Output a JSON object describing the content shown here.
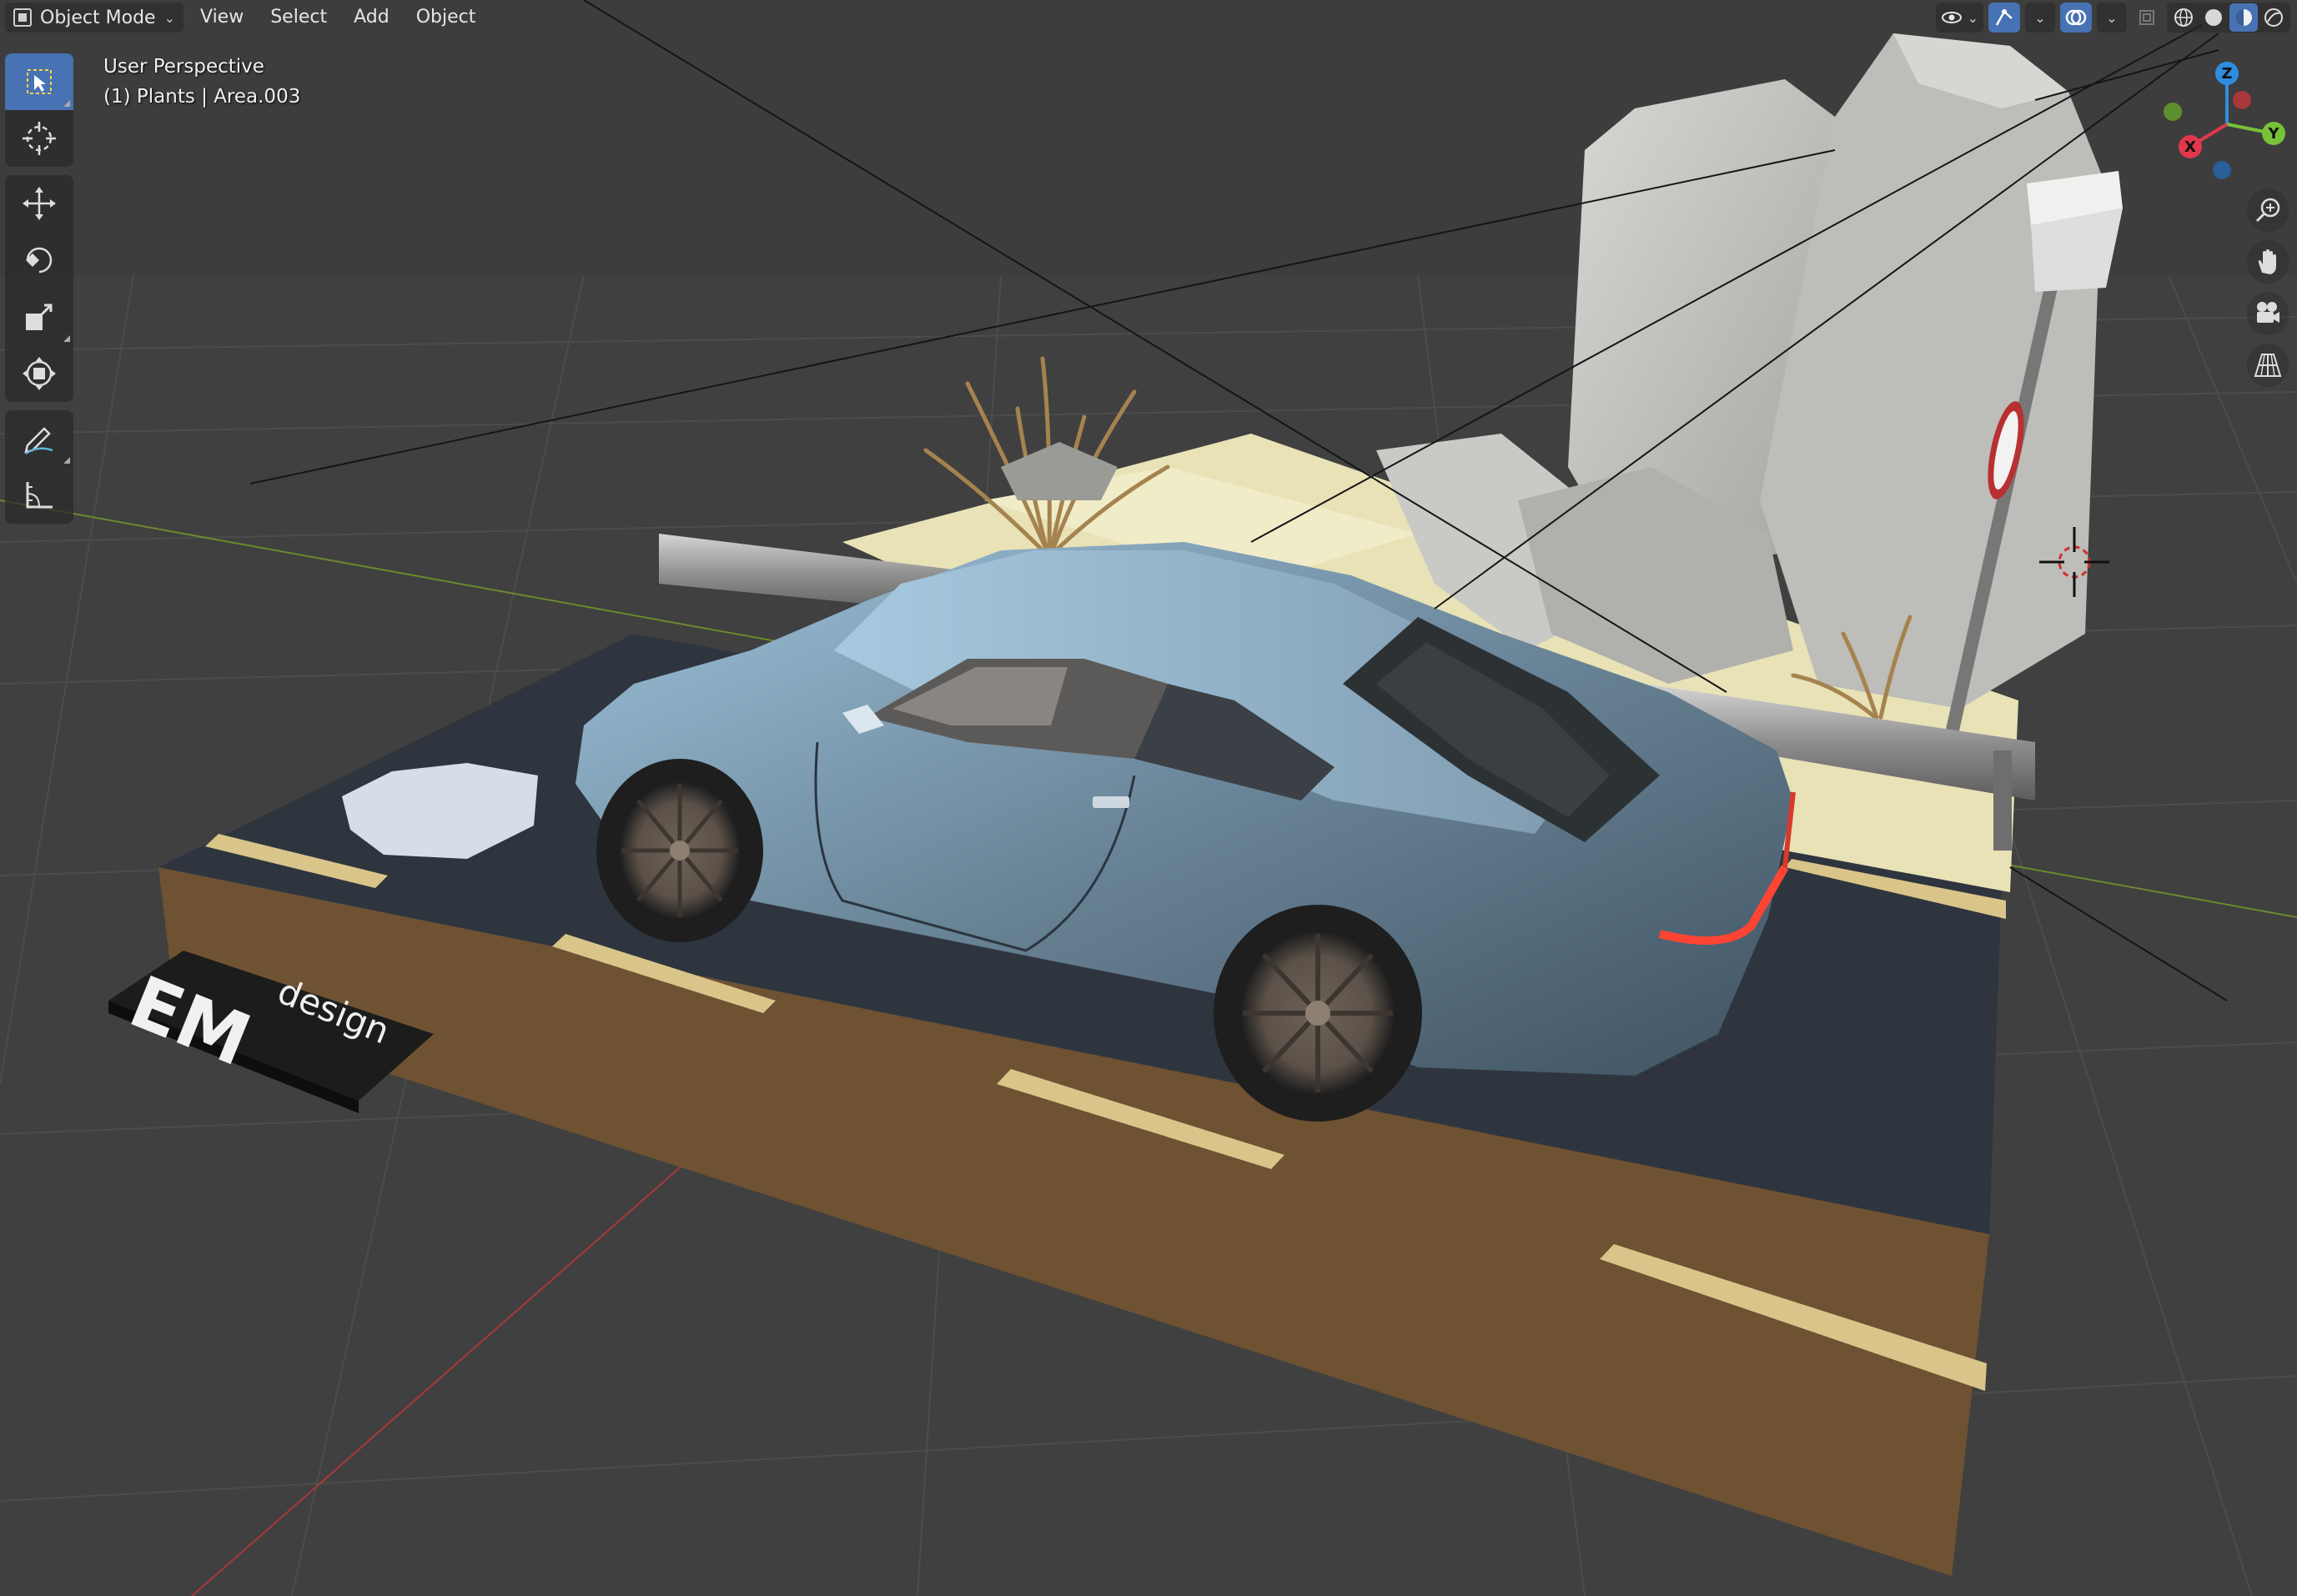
{
  "header": {
    "mode": "Object Mode",
    "menus": [
      "View",
      "Select",
      "Add",
      "Object"
    ]
  },
  "viewport": {
    "view_name": "User Perspective",
    "selection_info": "(1) Plants | Area.003"
  },
  "toolbar": {
    "tools": [
      "select-box",
      "cursor",
      "move",
      "rotate",
      "scale",
      "transform",
      "annotate",
      "measure"
    ]
  },
  "gizmo": {
    "axes": {
      "x": "X",
      "y": "Y",
      "z": "Z"
    },
    "colors": {
      "x": "#e0384a",
      "y": "#78c23a",
      "z": "#2f8de0"
    }
  },
  "scene": {
    "logo": {
      "main": "EM",
      "sub": "design"
    },
    "colors": {
      "background": "#3d3d3d",
      "asphalt": "#2f353f",
      "base_side": "#7a5a36",
      "sand": "#e8e2b6",
      "rock": "#c6c6c2",
      "car_body": "#6a8598",
      "stripe": "#d9c58a"
    }
  },
  "accent": "#4772b3"
}
